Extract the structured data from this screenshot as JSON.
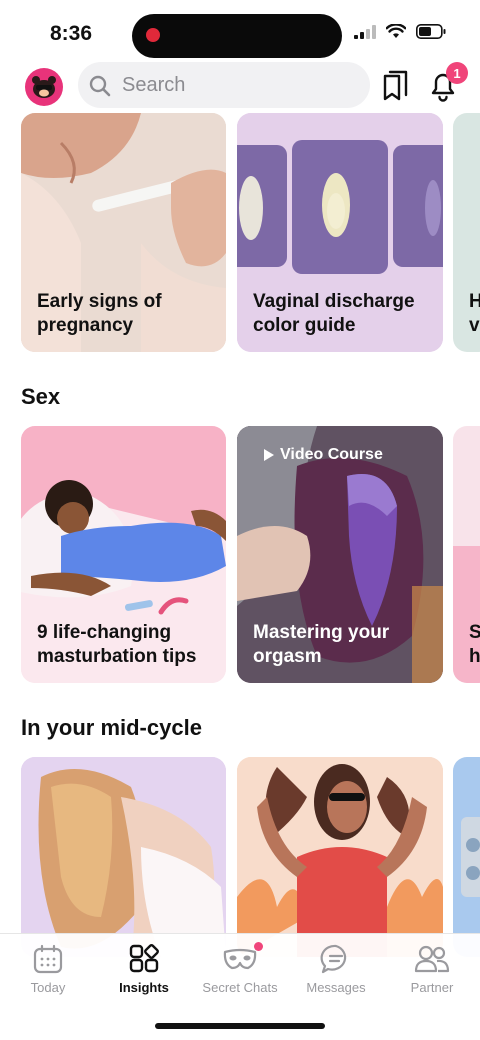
{
  "status": {
    "time": "8:36"
  },
  "search": {
    "placeholder": "Search"
  },
  "notifications": {
    "count": "1"
  },
  "sections": [
    {
      "title": "",
      "cards": [
        {
          "title": "Early signs of pregnancy"
        },
        {
          "title": "Vaginal discharge color guide"
        },
        {
          "title": "H v"
        }
      ]
    },
    {
      "title": "Sex",
      "cards": [
        {
          "title": "9 life-changing masturbation tips"
        },
        {
          "title": "Mastering your orgasm",
          "badge": "Video Course"
        },
        {
          "title": "S h"
        }
      ]
    },
    {
      "title": "In your mid-cycle",
      "cards": [
        {
          "title": ""
        },
        {
          "title": ""
        },
        {
          "title": ""
        }
      ]
    }
  ],
  "tabbar": {
    "items": [
      {
        "label": "Today",
        "icon": "calendar-icon"
      },
      {
        "label": "Insights",
        "icon": "grid-icon"
      },
      {
        "label": "Secret Chats",
        "icon": "mask-icon"
      },
      {
        "label": "Messages",
        "icon": "chat-icon"
      },
      {
        "label": "Partner",
        "icon": "people-icon"
      }
    ],
    "active": "Insights"
  },
  "colors": {
    "accent": "#f0457a",
    "avatar": "#e8337a"
  }
}
